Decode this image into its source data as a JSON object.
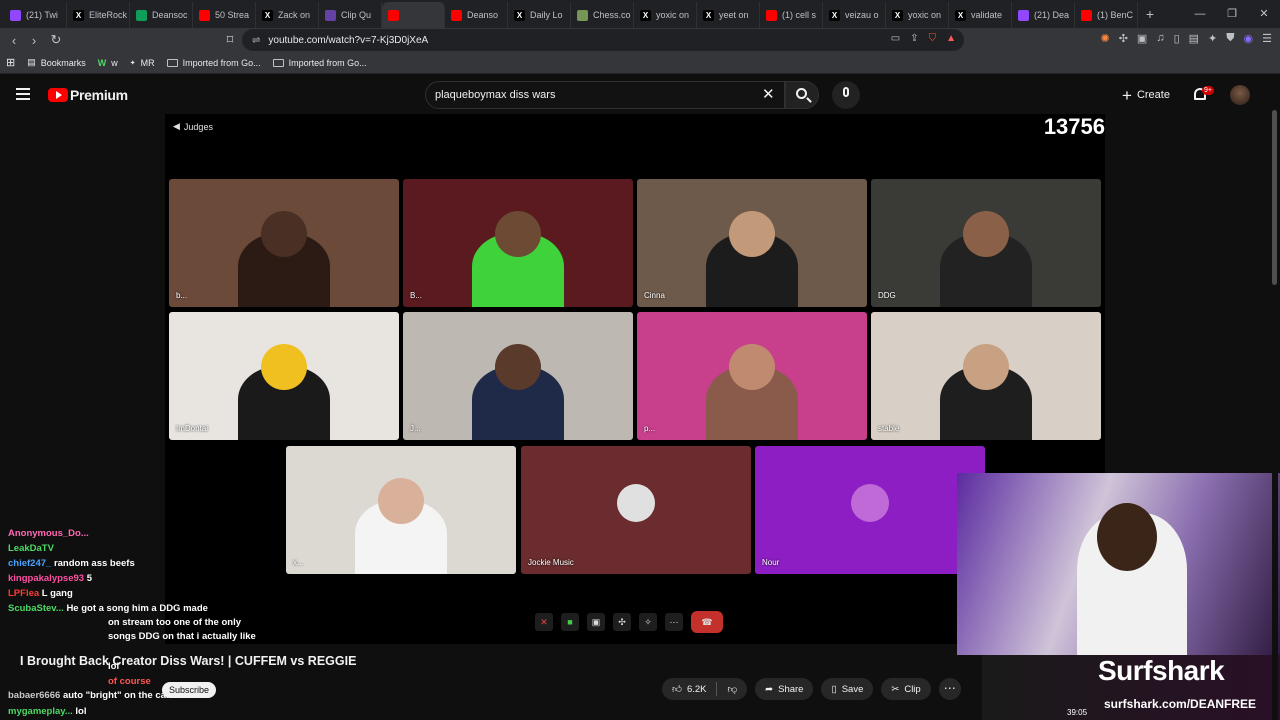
{
  "browser": {
    "tabs": [
      {
        "label": "(21) Twi",
        "fav_color": "#9146ff",
        "fav_char": ""
      },
      {
        "label": "EliteRock",
        "fav_color": "#000000",
        "fav_char": "X"
      },
      {
        "label": "Deansoc",
        "fav_color": "#0f9d58",
        "fav_char": ""
      },
      {
        "label": "50 Strea",
        "fav_color": "#ff0000",
        "fav_char": ""
      },
      {
        "label": "Zack on",
        "fav_color": "#000000",
        "fav_char": "X"
      },
      {
        "label": "Clip Qu",
        "fav_color": "#6441a5",
        "fav_char": ""
      },
      {
        "label": "",
        "fav_color": "#ff0000",
        "fav_char": ""
      },
      {
        "label": "Deanso",
        "fav_color": "#ff0000",
        "fav_char": ""
      },
      {
        "label": "Daily Lo",
        "fav_color": "#000000",
        "fav_char": "X"
      },
      {
        "label": "Chess.co",
        "fav_color": "#769656",
        "fav_char": ""
      },
      {
        "label": "yoxic on",
        "fav_color": "#000000",
        "fav_char": "X"
      },
      {
        "label": "yeet on",
        "fav_color": "#000000",
        "fav_char": "X"
      },
      {
        "label": "(1) cell s",
        "fav_color": "#ff0000",
        "fav_char": ""
      },
      {
        "label": "veizau o",
        "fav_color": "#000000",
        "fav_char": "X"
      },
      {
        "label": "yoxic on",
        "fav_color": "#000000",
        "fav_char": "X"
      },
      {
        "label": "validate",
        "fav_color": "#000000",
        "fav_char": "X"
      },
      {
        "label": "(21) Dea",
        "fav_color": "#9146ff",
        "fav_char": ""
      },
      {
        "label": "(1) BenC",
        "fav_color": "#ff0000",
        "fav_char": ""
      }
    ],
    "active_tab_index": 6,
    "url": "youtube.com/watch?v=7-Kj3D0jXeA",
    "bookmarks": [
      {
        "label": "Bookmarks"
      },
      {
        "label": "w"
      },
      {
        "label": "MR"
      },
      {
        "label": "Imported from Go..."
      },
      {
        "label": "Imported from Go..."
      }
    ]
  },
  "masthead": {
    "brand": "Premium",
    "search_value": "plaqueboymax diss wars",
    "create_label": "Create",
    "notif_badge": "9+"
  },
  "video": {
    "stage_label": "Judges",
    "viewer_count": "13756",
    "tiles": [
      {
        "name": "b...",
        "bg": "#6b4a3a",
        "person": "#2b1b14",
        "head": "#4a3024"
      },
      {
        "name": "B...",
        "bg": "#5a1a20",
        "person": "#3fd23a",
        "head": "#6d4a33"
      },
      {
        "name": "Cinna",
        "bg": "#6e5a4a",
        "person": "#1c1c1c",
        "head": "#c29a7a"
      },
      {
        "name": "DDG",
        "bg": "#3a3a36",
        "person": "#222222",
        "head": "#8a6048"
      },
      {
        "name": "ImDontai",
        "bg": "#e8e4e0",
        "person": "#1a1a1a",
        "head": "#f0c020"
      },
      {
        "name": "J...",
        "bg": "#bdb8b2",
        "person": "#1e2a48",
        "head": "#5a3a2a"
      },
      {
        "name": "p...",
        "bg": "#c83f8c",
        "person": "#8a5a4a",
        "head": "#c08a70"
      },
      {
        "name": "stable",
        "bg": "#d8d0c6",
        "person": "#1e1e1e",
        "head": "#c8a082"
      },
      {
        "name": "x...",
        "bg": "#dcd8d2",
        "person": "#f4f4f4",
        "head": "#d9b09a"
      },
      {
        "name": "Jockie Music",
        "bg": "#6a2c2e",
        "person": "",
        "head": "#e0e0e0"
      },
      {
        "name": "Nour",
        "bg": "#8c1ec4",
        "person": "",
        "head": "#c06ad8"
      }
    ],
    "chat": [
      {
        "user": "Anonymous_Do...",
        "user_color": "#ff69b4",
        "msg": ""
      },
      {
        "user": "LeakDaTV",
        "user_color": "#4cd964",
        "msg": ""
      },
      {
        "user": "chief247_",
        "user_color": "#4aa3ff",
        "msg": "random ass beefs"
      },
      {
        "user": "kingpakalypse93",
        "user_color": "#ff4fa3",
        "msg": "5"
      },
      {
        "user": "LPFlea",
        "user_color": "#ff3b30",
        "msg": "L gang"
      },
      {
        "user": "ScubaStev...",
        "user_color": "#4cd964",
        "msg": "He got a song him a DDG made"
      },
      {
        "user": "",
        "user_color": "#ffffff",
        "msg": "on stream too one of the only"
      },
      {
        "user": "",
        "user_color": "#ffffff",
        "msg": "songs DDG on that i actually like"
      },
      {
        "user": "",
        "user_color": "#ffffff",
        "msg": "lol"
      },
      {
        "user": "",
        "user_color": "#ff5555",
        "msg": "of course"
      },
      {
        "user": "babaer6666",
        "user_color": "#c8c8c8",
        "msg": "auto \"bright\" on the camera"
      },
      {
        "user": "mygameplay...",
        "user_color": "#4cd964",
        "msg": "lol"
      }
    ],
    "streamer_sponsor": "Surfshark",
    "sponsor_url": "surfshark.com/DEANFREE",
    "sponsor_time": "39:05"
  },
  "meta": {
    "title": "I Brought Back Creator Diss Wars! | CUFFEM vs REGGIE",
    "subscribe_label": "Subscribe",
    "likes": "6.2K",
    "share_label": "Share",
    "save_label": "Save",
    "clip_label": "Clip"
  }
}
